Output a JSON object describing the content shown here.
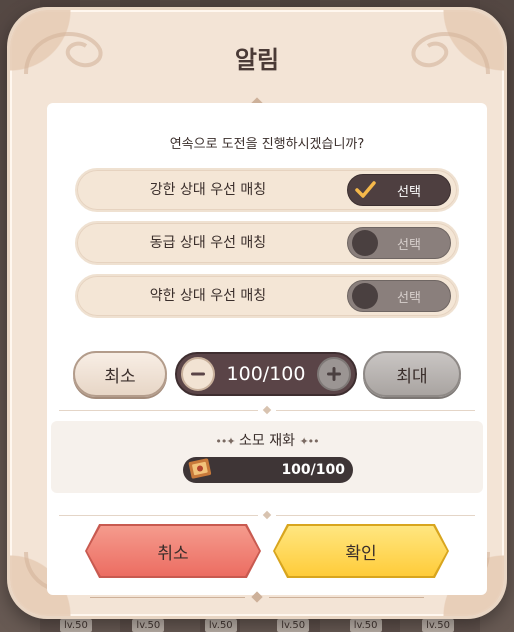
{
  "dialog": {
    "title": "알림",
    "question": "연속으로 도전을 진행하시겠습니까?"
  },
  "options": [
    {
      "label": "강한 상대 우선 매칭",
      "toggle_label": "선택",
      "selected": true
    },
    {
      "label": "동급 상대 우선 매칭",
      "toggle_label": "선택",
      "selected": false
    },
    {
      "label": "약한 상대 우선 매칭",
      "toggle_label": "선택",
      "selected": false
    }
  ],
  "quantity": {
    "min_label": "최소",
    "max_label": "최대",
    "value": "100/100"
  },
  "cost": {
    "title": "소모 재화",
    "value": "100/100",
    "icon": "ticket-icon"
  },
  "buttons": {
    "cancel_label": "취소",
    "confirm_label": "확인"
  },
  "background": {
    "labels": [
      "lv.50",
      "lv.50",
      "lv.50",
      "lv.50",
      "lv.50",
      "lv.50"
    ]
  },
  "colors": {
    "toggle_on": "#4e3f40",
    "toggle_off": "#8a7f7c",
    "cancel_button": "#ec6d62",
    "confirm_button": "#ffcc3a",
    "check_mark": "#f5b84a"
  }
}
